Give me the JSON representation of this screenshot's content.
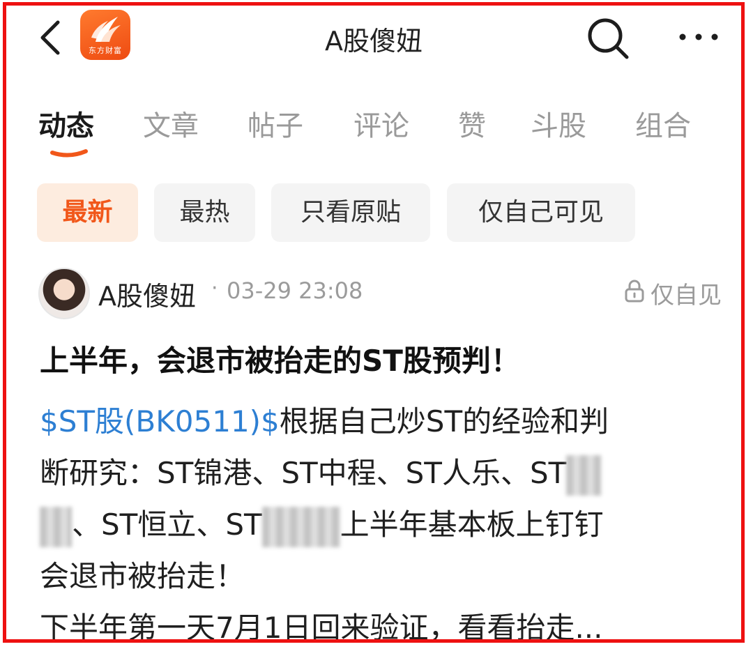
{
  "header": {
    "app_logo_text": "东方财富",
    "title": "A股傻妞"
  },
  "tabs": [
    {
      "label": "动态",
      "active": true
    },
    {
      "label": "文章",
      "active": false
    },
    {
      "label": "帖子",
      "active": false
    },
    {
      "label": "评论",
      "active": false
    },
    {
      "label": "赞",
      "active": false
    },
    {
      "label": "斗股",
      "active": false
    },
    {
      "label": "组合",
      "active": false
    }
  ],
  "filters": [
    {
      "label": "最新",
      "active": true
    },
    {
      "label": "最热",
      "active": false
    },
    {
      "label": "只看原贴",
      "active": false
    },
    {
      "label": "仅自己可见",
      "active": false
    }
  ],
  "post": {
    "author": "A股傻妞",
    "separator": "·",
    "timestamp": "03-29 23:08",
    "visibility": "仅自见",
    "title": "上半年，会退市被抬走的ST股预判！",
    "body": {
      "stock_link": "$ST股(BK0511)$",
      "line1_rest": "根据自己炒ST的经验和判",
      "line2": "断研究：ST锦港、ST中程、ST人乐、ST",
      "line3_a": "、ST恒立、ST",
      "line3_b": "上半年基本板上钉钉",
      "line4": "会退市被抬走！",
      "line5": "下半年第一天7月1日回来验证，看看抬走..."
    }
  },
  "colors": {
    "accent": "#f1571a",
    "link": "#2d7fd3",
    "frame": "#ee1111"
  }
}
